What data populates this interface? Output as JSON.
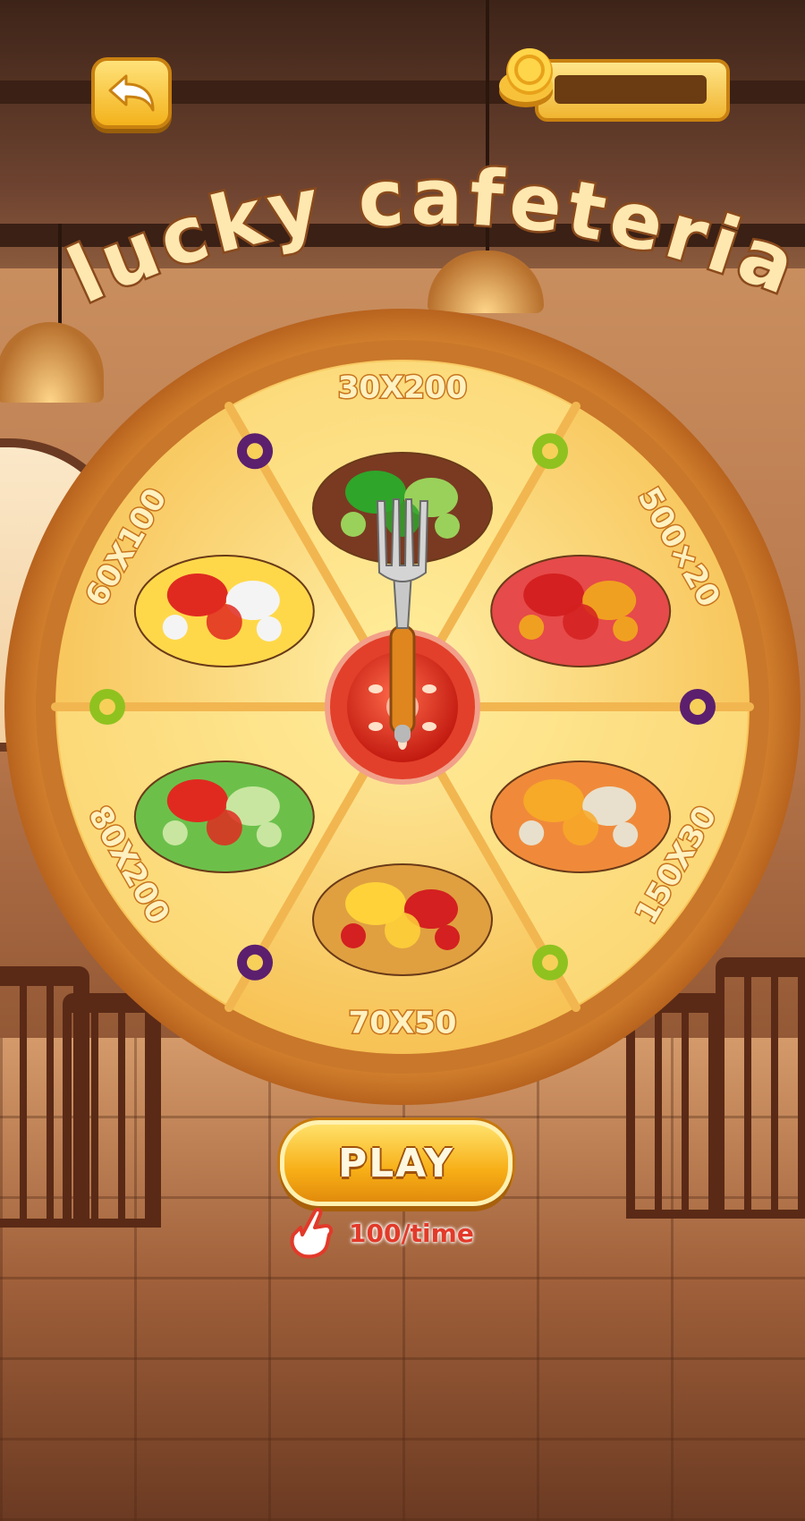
{
  "header": {
    "back_icon": "back-arrow-icon",
    "coin_icon": "gold-coins-icon",
    "coin_balance": ""
  },
  "title": "lucky cafeteria",
  "wheel": {
    "segments": [
      {
        "prize": "30X200",
        "food": "grilled patty with jalapeno, onion and cucumber"
      },
      {
        "prize": "500×20",
        "food": "steak with ketchup and mustard"
      },
      {
        "prize": "150X30",
        "food": "grilled salmon with mustard"
      },
      {
        "prize": "70X50",
        "food": "burger with pepper and cheese"
      },
      {
        "prize": "80X200",
        "food": "salad with tomato, pepper and cucumber"
      },
      {
        "prize": "60X100",
        "food": "pizza slice with pepper and mushroom"
      }
    ],
    "pointer_icon": "fork-icon",
    "hub_icon": "tomato-slice-icon",
    "olive_colors": [
      "#8fc21f",
      "#5b1f6e"
    ]
  },
  "play": {
    "label": "PLAY",
    "cost_icon": "tap-hand-icon",
    "cost_text": "100/time"
  },
  "colors": {
    "gold": "#f7ae16",
    "crust": "#d9812b",
    "cheese": "#fde48a",
    "cost_red": "#e23a2a"
  }
}
